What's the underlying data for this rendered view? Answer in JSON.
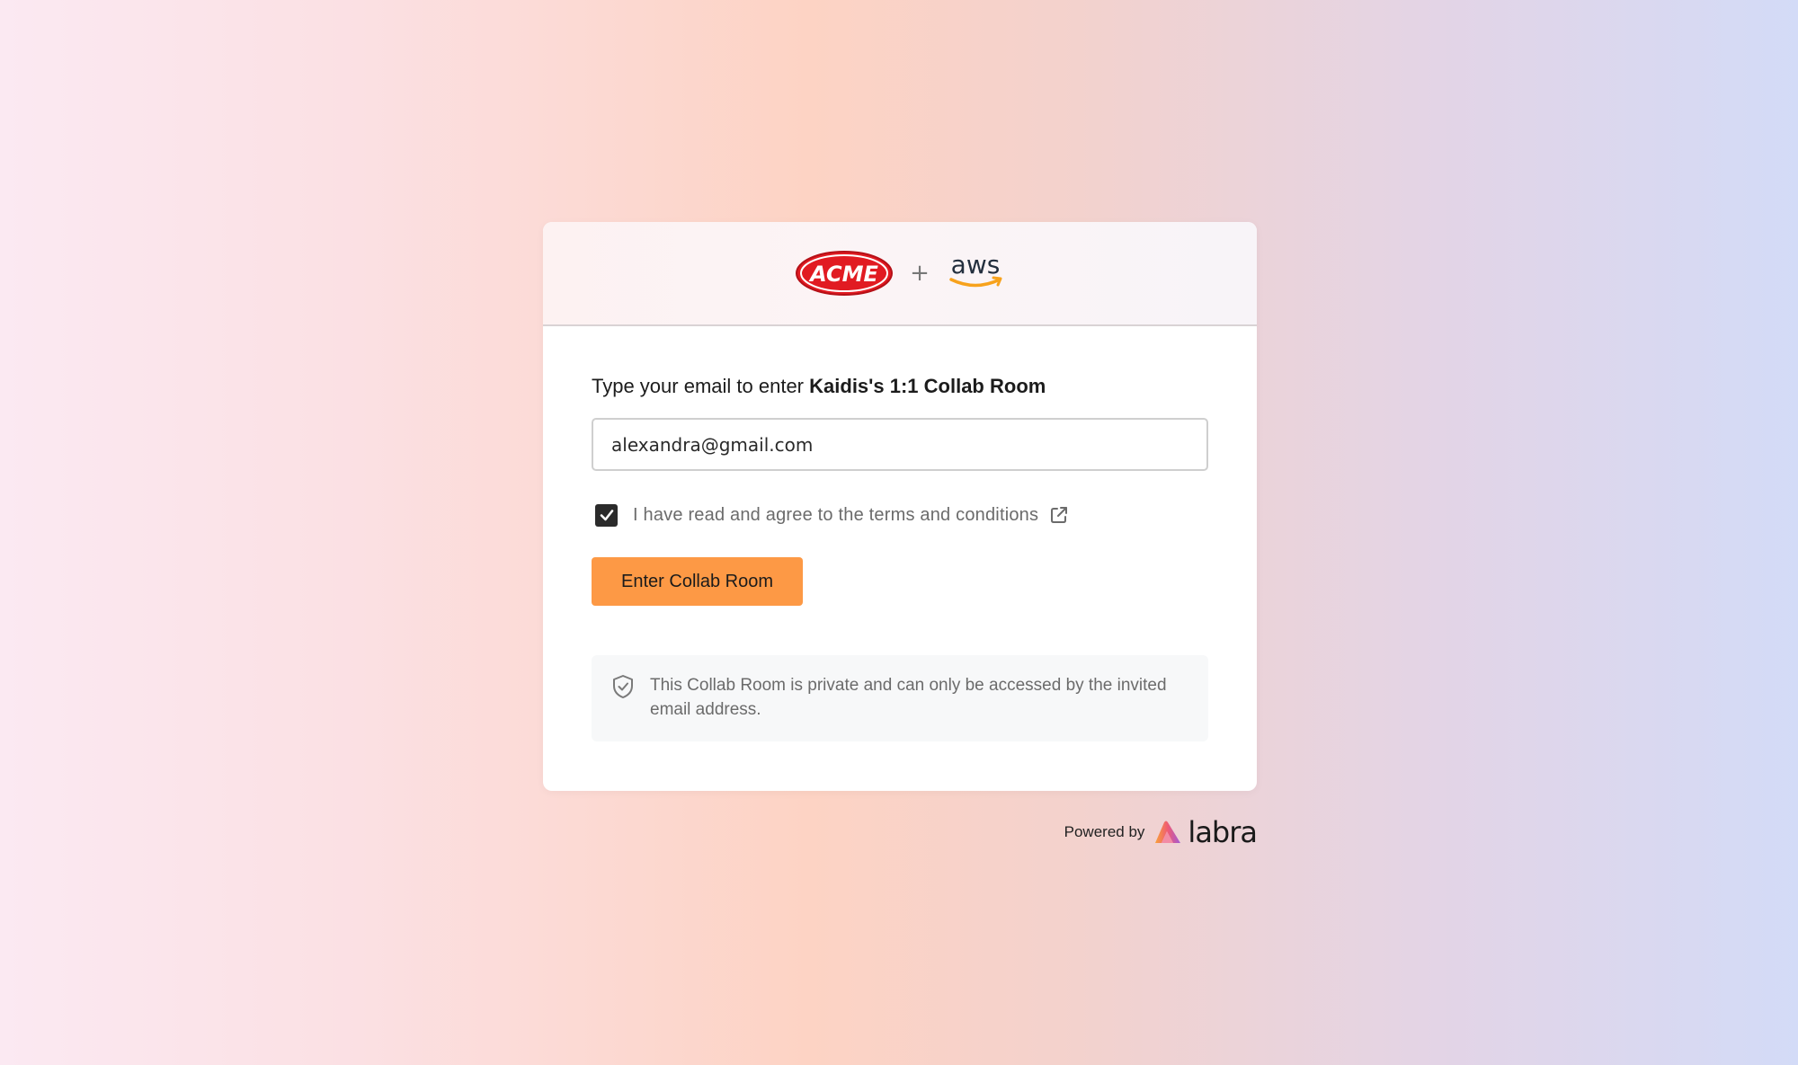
{
  "header": {
    "partner_logo_text": "ACME",
    "separator": "+",
    "aws_logo_text": "aws",
    "partner_logo_name": "acme-logo",
    "aws_logo_name": "aws-logo"
  },
  "form": {
    "prompt_prefix": "Type your email to enter",
    "room_name": "Kaidis's 1:1 Collab Room",
    "email_value": "alexandra@gmail.com",
    "terms_checked": true,
    "terms_label": "I have read and agree to the terms and conditions",
    "terms_link_icon": "external-link-icon",
    "submit_label": "Enter Collab Room",
    "privacy_icon": "shield-check-icon",
    "privacy_note": "This Collab Room is private and can only be accessed by the invited email address."
  },
  "footer": {
    "powered_by_label": "Powered by",
    "brand_name": "labra"
  },
  "colors": {
    "accent_button": "#fd9945",
    "acme_red": "#e11b22",
    "aws_orange": "#f7a21c",
    "aws_navy": "#232f3e"
  }
}
